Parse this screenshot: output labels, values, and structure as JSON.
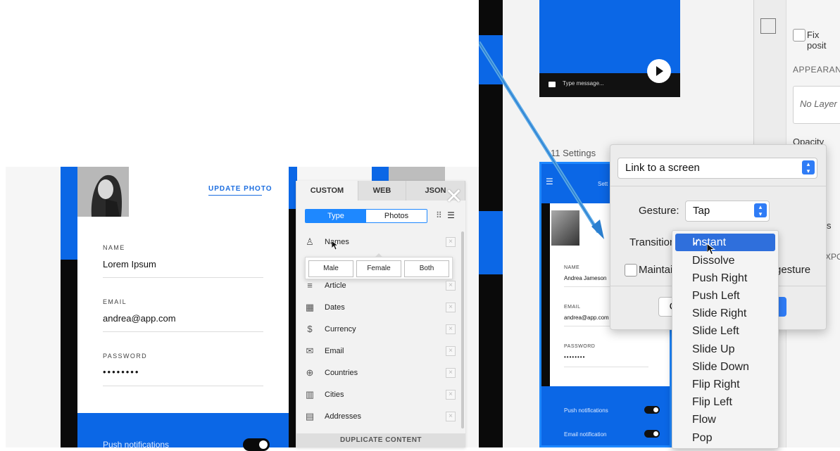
{
  "left": {
    "profile": {
      "update_photo": "UPDATE PHOTO",
      "name_label": "NAME",
      "name_value": "Lorem Ipsum",
      "email_label": "EMAIL",
      "email_value": "andrea@app.com",
      "password_label": "PASSWORD",
      "password_value": "••••••••",
      "push_label": "Push notifications"
    },
    "plugin": {
      "tabs": [
        "CUSTOM",
        "WEB",
        "JSON"
      ],
      "segment": [
        "Type",
        "Photos"
      ],
      "items": [
        {
          "icon": "person-icon",
          "label": "Names"
        },
        {
          "icon": "article-icon",
          "label": "Article"
        },
        {
          "icon": "calendar-icon",
          "label": "Dates"
        },
        {
          "icon": "dollar-icon",
          "label": "Currency"
        },
        {
          "icon": "mail-icon",
          "label": "Email"
        },
        {
          "icon": "globe-icon",
          "label": "Countries"
        },
        {
          "icon": "building-icon",
          "label": "Cities"
        },
        {
          "icon": "address-icon",
          "label": "Addresses"
        }
      ],
      "gender_options": [
        "Male",
        "Female",
        "Both"
      ],
      "duplicate": "DUPLICATE CONTENT"
    }
  },
  "right": {
    "chat": {
      "placeholder": "Type message..."
    },
    "settings_title": "11 Settings",
    "phone": {
      "header": "Sett",
      "name_label": "NAME",
      "name_value": "Andrea Jameson",
      "email_label": "EMAIL",
      "email_value": "andrea@app.com",
      "password_label": "PASSWORD",
      "password_value": "••••••••",
      "push_label": "Push notifications",
      "email_notif_label": "Email notification"
    },
    "inspector": {
      "fix_position": "Fix posit",
      "appearance": "APPEARANC",
      "no_layer": "No Layer",
      "opacity": "Opacity (No",
      "s_text": "s",
      "expo": "XPO"
    },
    "dialog": {
      "link_select": "Link to a screen",
      "gesture_label": "Gesture:",
      "gesture_value": "Tap",
      "transition_label": "Transition",
      "maintain_label": "Maintai",
      "gesture_suffix": "gesture",
      "cancel_partial": "C"
    },
    "dropdown": {
      "selected": "Instant",
      "options": [
        "Instant",
        "Dissolve",
        "Push Right",
        "Push Left",
        "Slide Right",
        "Slide Left",
        "Slide Up",
        "Slide Down",
        "Flip Right",
        "Flip Left",
        "Flow",
        "Pop"
      ]
    }
  },
  "colors": {
    "brand_blue": "#0b67e6",
    "accent_blue": "#1e88ff",
    "select_blue": "#2f6fdc"
  }
}
